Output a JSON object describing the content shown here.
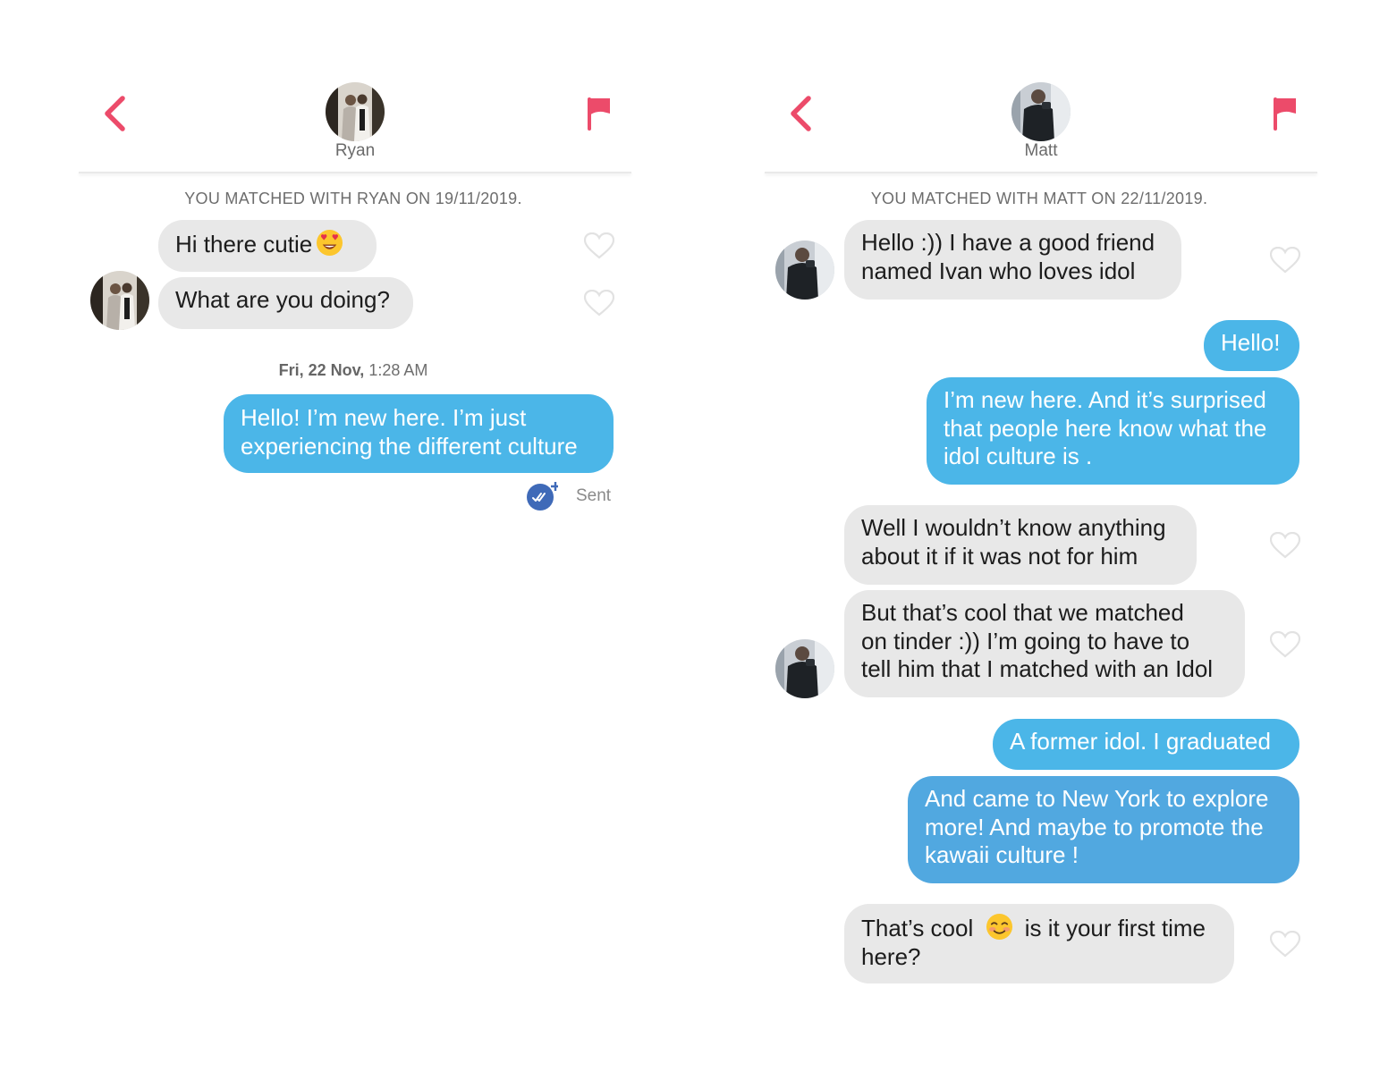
{
  "colors": {
    "accent": "#ec4b6a",
    "outgoing_bubble": "#4bb6e8",
    "incoming_bubble": "#e8e8e8"
  },
  "left": {
    "contact_name": "Ryan",
    "matched_text": "YOU MATCHED WITH RYAN ON 19/11/2019.",
    "messages_in": [
      {
        "text": "Hi there cutie",
        "emoji": "heart-eyes-emoji"
      },
      {
        "text": "What are you doing?"
      }
    ],
    "timestamp_day": "Fri, 22 Nov,",
    "timestamp_time": "1:28 AM",
    "messages_out": [
      {
        "lines": [
          "Hello! I’m new here. I’m just",
          "experiencing the different culture"
        ]
      }
    ],
    "status": "Sent"
  },
  "right": {
    "contact_name": "Matt",
    "matched_text": "YOU MATCHED WITH MATT ON 22/11/2019.",
    "m1": [
      "Hello :)) I have a good friend",
      "named Ivan who loves idol"
    ],
    "m2": [
      "Hello!"
    ],
    "m3": [
      "I’m new here. And it’s surprised",
      "that people here know what the",
      "idol culture is ."
    ],
    "m4": [
      "Well I wouldn’t know anything",
      "about it if it was not for him"
    ],
    "m5": [
      "But that’s cool that we matched",
      "on tinder :)) I’m going to have to",
      "tell him that I matched with an Idol"
    ],
    "m6": [
      "A former idol. I graduated"
    ],
    "m7": [
      "And came to New York to explore",
      "more! And maybe to promote the",
      "kawaii culture !"
    ],
    "m8": {
      "before": "That’s cool",
      "after": "is it your first time",
      "line2": "here?",
      "emoji": "smiling-blush-emoji"
    }
  }
}
